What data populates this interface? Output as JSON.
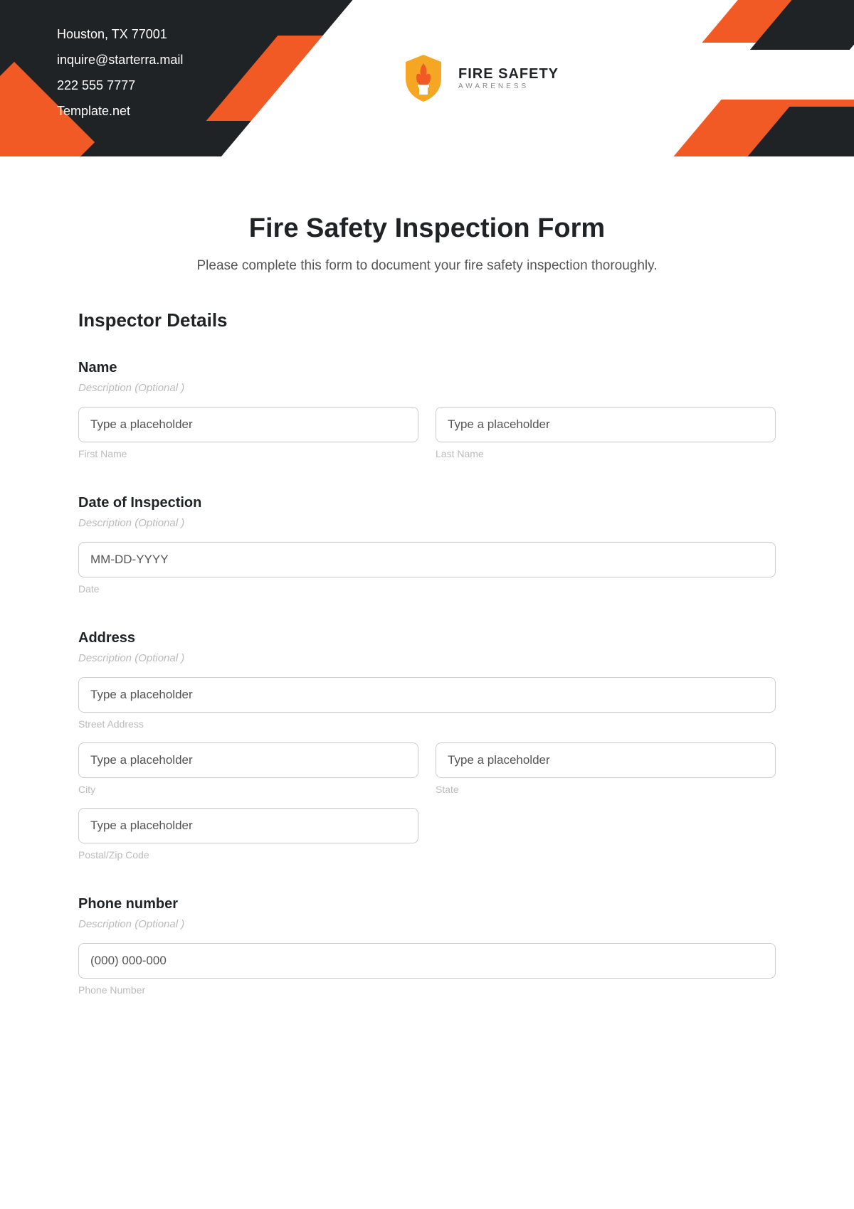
{
  "header": {
    "address": "Houston, TX 77001",
    "email": "inquire@starterra.mail",
    "phone": "222 555 7777",
    "site": "Template.net",
    "logo_title": "FIRE SAFETY",
    "logo_sub": "AWARENESS"
  },
  "page": {
    "title": "Fire Safety Inspection Form",
    "subtitle": "Please complete this form to document your fire safety inspection thoroughly."
  },
  "section1": {
    "title": "Inspector Details"
  },
  "fields": {
    "name": {
      "label": "Name",
      "desc": "Description (Optional )",
      "first_ph": "Type a placeholder",
      "first_sub": "First Name",
      "last_ph": "Type a placeholder",
      "last_sub": "Last Name"
    },
    "date": {
      "label": "Date of Inspection",
      "desc": "Description (Optional )",
      "ph": "MM-DD-YYYY",
      "sub": "Date"
    },
    "address": {
      "label": "Address",
      "desc": "Description (Optional )",
      "street_ph": "Type a placeholder",
      "street_sub": "Street Address",
      "city_ph": "Type a placeholder",
      "city_sub": "City",
      "state_ph": "Type a placeholder",
      "state_sub": "State",
      "zip_ph": "Type a placeholder",
      "zip_sub": "Postal/Zip Code"
    },
    "phone": {
      "label": "Phone number",
      "desc": "Description (Optional )",
      "ph": "(000) 000-000",
      "sub": "Phone Number"
    }
  }
}
